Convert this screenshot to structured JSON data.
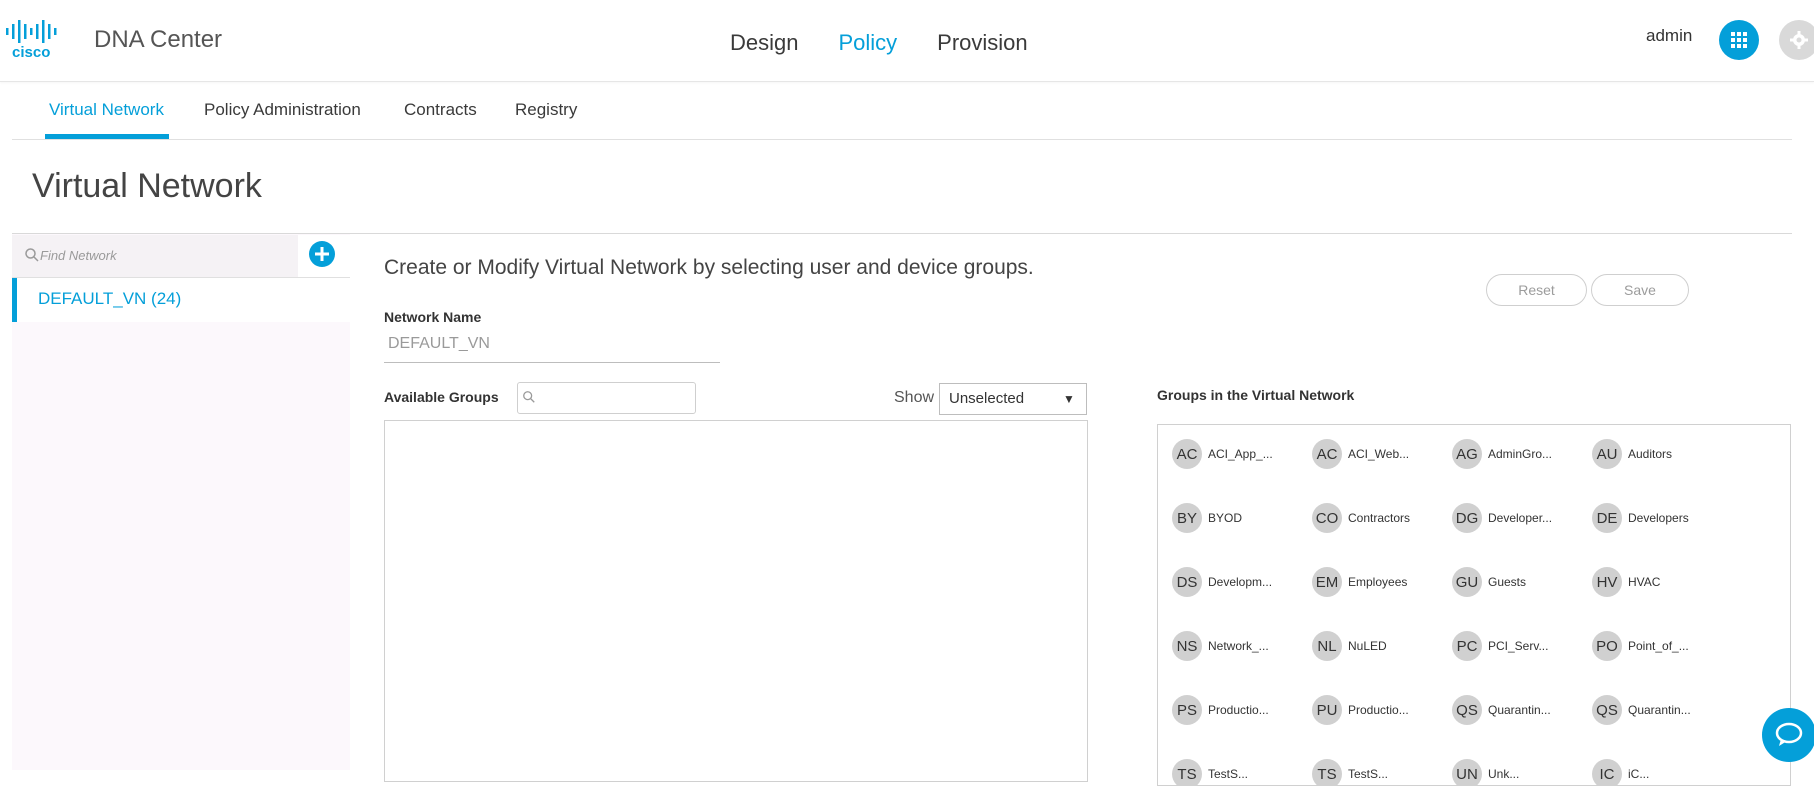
{
  "header": {
    "logo_text": "cisco",
    "app_title": "DNA Center",
    "nav": [
      {
        "label": "Design",
        "active": false
      },
      {
        "label": "Policy",
        "active": true
      },
      {
        "label": "Provision",
        "active": false
      }
    ],
    "user": "admin",
    "apps_icon": "apps-grid-icon",
    "settings_icon": "gear-icon"
  },
  "subnav": {
    "tabs": [
      {
        "label": "Virtual Network",
        "active": true
      },
      {
        "label": "Policy Administration",
        "active": false
      },
      {
        "label": "Contracts",
        "active": false
      },
      {
        "label": "Registry",
        "active": false
      }
    ]
  },
  "page_title": "Virtual Network",
  "sidebar": {
    "search_placeholder": "Find Network",
    "search_icon": "search-icon",
    "add_icon": "plus-circle-icon",
    "networks": [
      {
        "label": "DEFAULT_VN (24)",
        "selected": true
      }
    ]
  },
  "main": {
    "intro": "Create or Modify Virtual Network by selecting user and device groups.",
    "reset_label": "Reset",
    "save_label": "Save",
    "network_name_label": "Network Name",
    "network_name_value": "DEFAULT_VN",
    "available_groups_label": "Available Groups",
    "groups_search_icon": "search-icon",
    "show_label": "Show",
    "show_value": "Unselected",
    "groups_in_vn_label": "Groups in the Virtual Network",
    "groups": [
      {
        "abbr": "AC",
        "name": "ACI_App_..."
      },
      {
        "abbr": "AC",
        "name": "ACI_Web..."
      },
      {
        "abbr": "AG",
        "name": "AdminGro..."
      },
      {
        "abbr": "AU",
        "name": "Auditors"
      },
      {
        "abbr": "BY",
        "name": "BYOD"
      },
      {
        "abbr": "CO",
        "name": "Contractors"
      },
      {
        "abbr": "DG",
        "name": "Developer..."
      },
      {
        "abbr": "DE",
        "name": "Developers"
      },
      {
        "abbr": "DS",
        "name": "Developm..."
      },
      {
        "abbr": "EM",
        "name": "Employees"
      },
      {
        "abbr": "GU",
        "name": "Guests"
      },
      {
        "abbr": "HV",
        "name": "HVAC"
      },
      {
        "abbr": "NS",
        "name": "Network_..."
      },
      {
        "abbr": "NL",
        "name": "NuLED"
      },
      {
        "abbr": "PC",
        "name": "PCI_Serv..."
      },
      {
        "abbr": "PO",
        "name": "Point_of_..."
      },
      {
        "abbr": "PS",
        "name": "Productio..."
      },
      {
        "abbr": "PU",
        "name": "Productio..."
      },
      {
        "abbr": "QS",
        "name": "Quarantin..."
      },
      {
        "abbr": "QS",
        "name": "Quarantin..."
      },
      {
        "abbr": "TS",
        "name": "TestS..."
      },
      {
        "abbr": "TS",
        "name": "TestS..."
      },
      {
        "abbr": "UN",
        "name": "Unk..."
      },
      {
        "abbr": "IC",
        "name": "iC..."
      }
    ],
    "chat_icon": "chat-bubble-icon"
  },
  "colors": {
    "accent": "#049fd9",
    "chip_avatar": "#d0d0d0",
    "sidebar_bg": "#fcf8fc"
  }
}
